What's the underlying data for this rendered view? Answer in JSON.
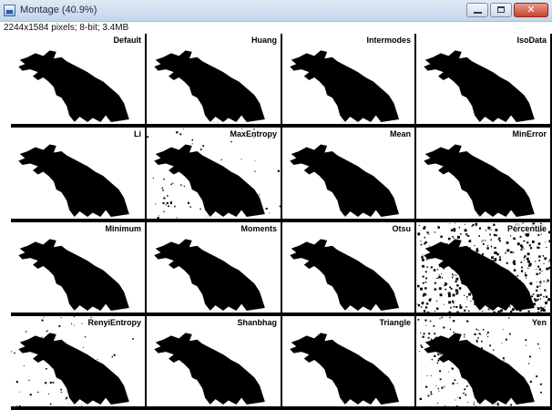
{
  "window": {
    "title": "Montage (40.9%)",
    "icon": "imagej-app-icon",
    "controls": {
      "close_glyph": "✕"
    }
  },
  "info_bar": "2244x1584 pixels; 8-bit; 3.4MB",
  "montage": {
    "columns": 4,
    "rows": 4,
    "cells": [
      {
        "label": "Default",
        "caption": "Default",
        "noise": 0
      },
      {
        "label": "Huang",
        "caption": "Huang",
        "noise": 0
      },
      {
        "label": "Intermodes",
        "caption": "Intermodes",
        "noise": 0
      },
      {
        "label": "IsoData",
        "caption": "IsoData",
        "noise": 0
      },
      {
        "label": "Li",
        "caption": "Li",
        "noise": 0
      },
      {
        "label": "MaxEntropy",
        "caption": "MaxEntropy",
        "noise": 1
      },
      {
        "label": "Mean",
        "caption": "Mean",
        "noise": 0
      },
      {
        "label": "MinError",
        "caption": "MinError",
        "noise": 0
      },
      {
        "label": "Minimum",
        "caption": "Minimum",
        "noise": 0
      },
      {
        "label": "Moments",
        "caption": "Moments",
        "noise": 0
      },
      {
        "label": "Otsu",
        "caption": "Otsu",
        "noise": 0
      },
      {
        "label": "Percentile",
        "caption": "Percentile",
        "noise": 3
      },
      {
        "label": "RenyiEntropy",
        "caption": "RenyiEntropy",
        "noise": 1
      },
      {
        "label": "Shanbhag",
        "caption": "Shanbhag",
        "noise": 0
      },
      {
        "label": "Triangle",
        "caption": "Triangle",
        "noise": 0
      },
      {
        "label": "Yen",
        "caption": "Yen",
        "noise": 2
      }
    ]
  }
}
